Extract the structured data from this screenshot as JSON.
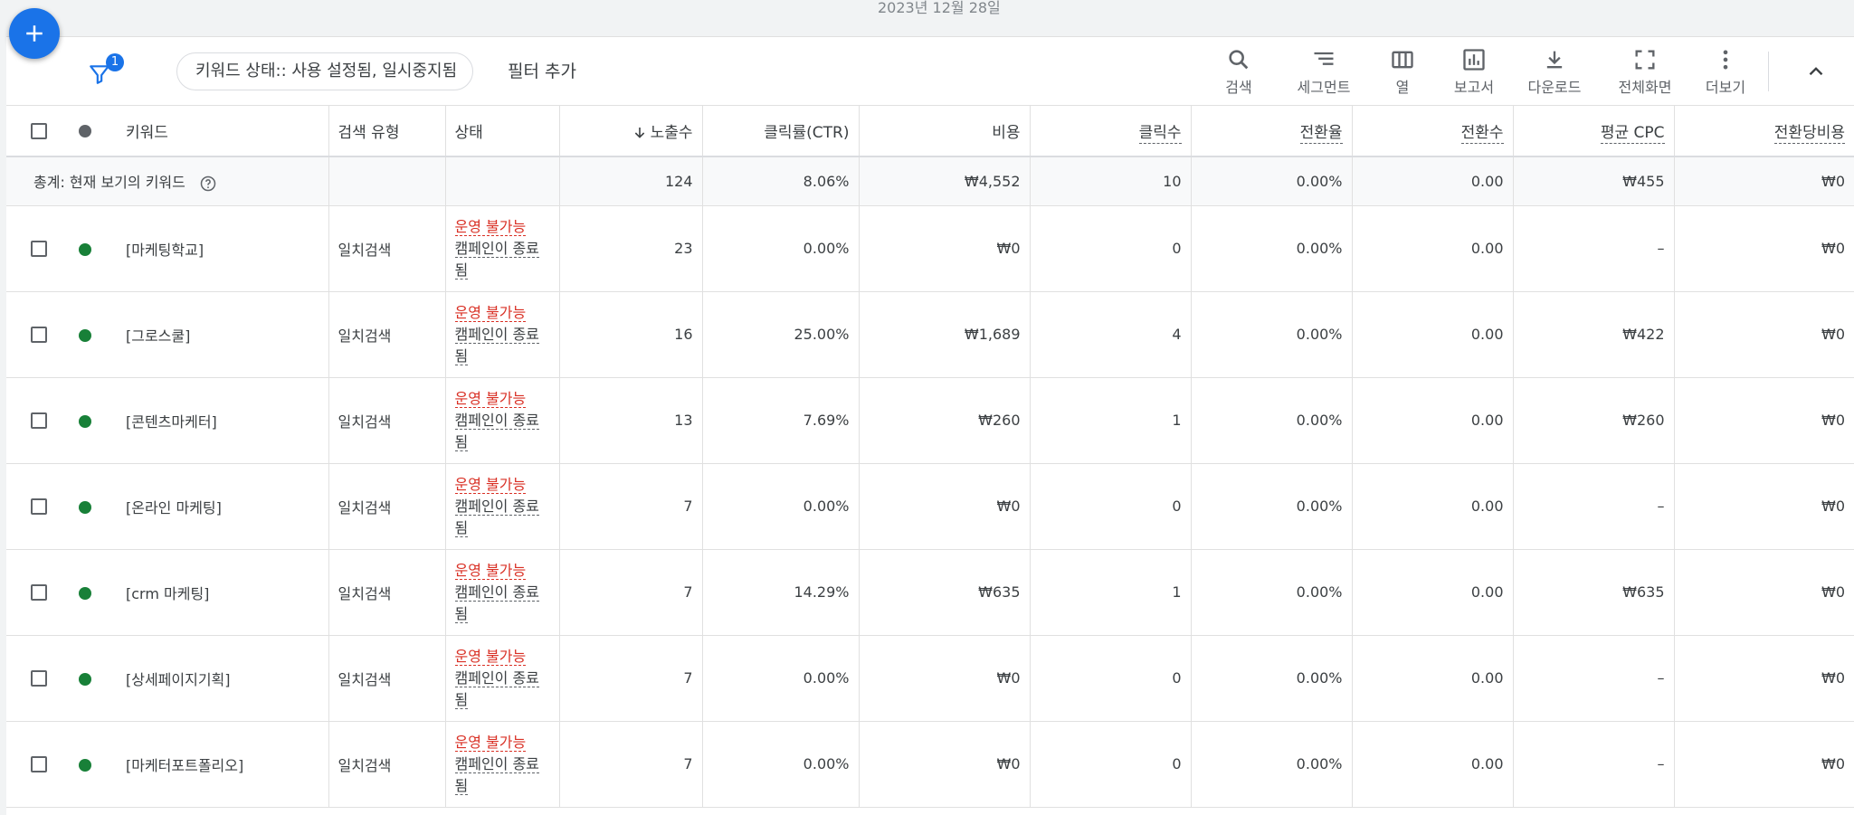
{
  "date_range": "2023년 12월 28일",
  "filter": {
    "badge": "1",
    "chip": "키워드 상태:: 사용 설정됨, 일시중지됨",
    "add_label": "필터 추가"
  },
  "toolbar": {
    "search": "검색",
    "segment": "세그먼트",
    "columns": "열",
    "reports": "보고서",
    "download": "다운로드",
    "fullscreen": "전체화면",
    "more": "더보기"
  },
  "table": {
    "headers": {
      "keyword": "키워드",
      "match_type": "검색 유형",
      "status": "상태",
      "impressions": "노출수",
      "ctr": "클릭률(CTR)",
      "cost": "비용",
      "clicks": "클릭수",
      "conv_rate": "전환율",
      "conversions": "전환수",
      "avg_cpc": "평균 CPC",
      "cost_per_conv": "전환당비용"
    },
    "total": {
      "label": "총계: 현재 보기의 키워드",
      "impressions": "124",
      "ctr": "8.06%",
      "cost": "₩4,552",
      "clicks": "10",
      "conv_rate": "0.00%",
      "conversions": "0.00",
      "avg_cpc": "₩455",
      "cost_per_conv": "₩0"
    },
    "rows": [
      {
        "keyword": "[마케팅학교]",
        "match_type": "일치검색",
        "status": "운영 불가능",
        "status_detail": "캠페인이 종료됨",
        "impressions": "23",
        "ctr": "0.00%",
        "cost": "₩0",
        "clicks": "0",
        "conv_rate": "0.00%",
        "conversions": "0.00",
        "avg_cpc": "–",
        "cost_per_conv": "₩0"
      },
      {
        "keyword": "[그로스쿨]",
        "match_type": "일치검색",
        "status": "운영 불가능",
        "status_detail": "캠페인이 종료됨",
        "impressions": "16",
        "ctr": "25.00%",
        "cost": "₩1,689",
        "clicks": "4",
        "conv_rate": "0.00%",
        "conversions": "0.00",
        "avg_cpc": "₩422",
        "cost_per_conv": "₩0"
      },
      {
        "keyword": "[콘텐츠마케터]",
        "match_type": "일치검색",
        "status": "운영 불가능",
        "status_detail": "캠페인이 종료됨",
        "impressions": "13",
        "ctr": "7.69%",
        "cost": "₩260",
        "clicks": "1",
        "conv_rate": "0.00%",
        "conversions": "0.00",
        "avg_cpc": "₩260",
        "cost_per_conv": "₩0"
      },
      {
        "keyword": "[온라인 마케팅]",
        "match_type": "일치검색",
        "status": "운영 불가능",
        "status_detail": "캠페인이 종료됨",
        "impressions": "7",
        "ctr": "0.00%",
        "cost": "₩0",
        "clicks": "0",
        "conv_rate": "0.00%",
        "conversions": "0.00",
        "avg_cpc": "–",
        "cost_per_conv": "₩0"
      },
      {
        "keyword": "[crm 마케팅]",
        "match_type": "일치검색",
        "status": "운영 불가능",
        "status_detail": "캠페인이 종료됨",
        "impressions": "7",
        "ctr": "14.29%",
        "cost": "₩635",
        "clicks": "1",
        "conv_rate": "0.00%",
        "conversions": "0.00",
        "avg_cpc": "₩635",
        "cost_per_conv": "₩0"
      },
      {
        "keyword": "[상세페이지기획]",
        "match_type": "일치검색",
        "status": "운영 불가능",
        "status_detail": "캠페인이 종료됨",
        "impressions": "7",
        "ctr": "0.00%",
        "cost": "₩0",
        "clicks": "0",
        "conv_rate": "0.00%",
        "conversions": "0.00",
        "avg_cpc": "–",
        "cost_per_conv": "₩0"
      },
      {
        "keyword": "[마케터포트폴리오]",
        "match_type": "일치검색",
        "status": "운영 불가능",
        "status_detail": "캠페인이 종료됨",
        "impressions": "7",
        "ctr": "0.00%",
        "cost": "₩0",
        "clicks": "0",
        "conv_rate": "0.00%",
        "conversions": "0.00",
        "avg_cpc": "–",
        "cost_per_conv": "₩0"
      }
    ]
  },
  "colors": {
    "accent": "#1a73e8",
    "status_error": "#d93025",
    "enabled_dot": "#188038"
  },
  "icons": [
    "plus-icon",
    "filter-icon",
    "search-icon",
    "segment-icon",
    "columns-icon",
    "reports-icon",
    "download-icon",
    "fullscreen-icon",
    "more-vert-icon",
    "chevron-up-icon",
    "help-icon",
    "arrow-down-icon"
  ]
}
